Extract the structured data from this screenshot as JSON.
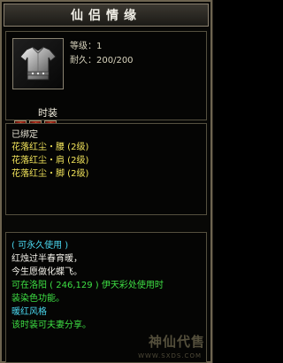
{
  "window": {
    "title": "仙侣情缘"
  },
  "item": {
    "icon": "armor-icon",
    "level_text": "等级：1",
    "durability_text": "耐久：200/200"
  },
  "fashion": {
    "label": "时装",
    "slots": [
      "fashion-slot-icon",
      "fashion-slot-icon",
      "fashion-slot-icon"
    ]
  },
  "sets": {
    "bound_label": "已绑定",
    "rows": [
      "花落红尘・腰 (2级)",
      "花落红尘・肩 (2级)",
      "花落红尘・脚 (2级)"
    ]
  },
  "description": {
    "usage": "( 可永久使用 )",
    "poem_line_1": "红烛过半春宵暖，",
    "poem_line_2": "今生愿做化蝶飞。",
    "location_line_1": "可在洛阳 ( 246,129 ) 伊天彩处使用时",
    "location_line_2": "装染色功能。",
    "style_line": "暖红风格",
    "share_line": "该时装可夫妻分享。"
  },
  "watermark": {
    "brand": "神仙代售",
    "url": "WWW.SXDS.COM"
  },
  "colors": {
    "set_text": "#f0e25a",
    "cyan_text": "#49d6ee",
    "green_text": "#3ee044",
    "frame": "#6d6450"
  }
}
